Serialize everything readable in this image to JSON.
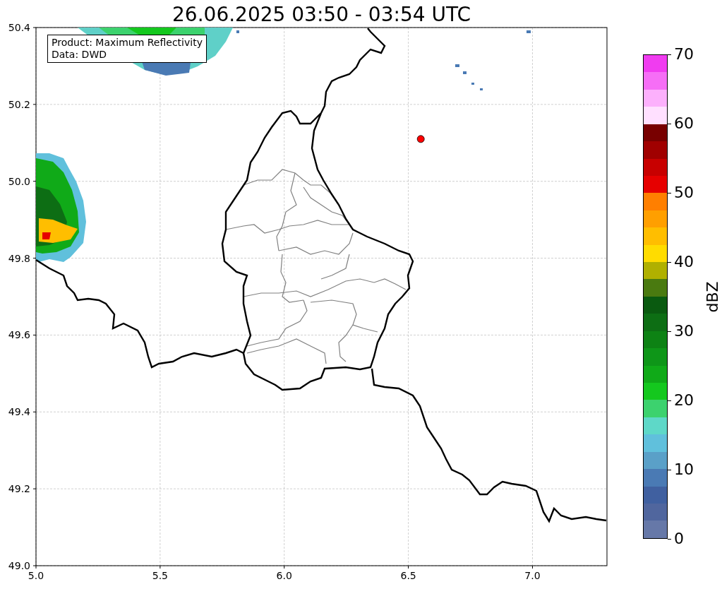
{
  "title": "26.06.2025 03:50 - 03:54 UTC",
  "legend": {
    "lines": [
      "Product: Maximum Reflectivity",
      "Data: DWD"
    ]
  },
  "map": {
    "chart_data": {
      "type": "scatter",
      "xlim": [
        5.0,
        7.3
      ],
      "ylim": [
        49.0,
        50.4
      ],
      "xticks": [
        {
          "value": 5.0,
          "label": "5.0"
        },
        {
          "value": 5.5,
          "label": "5.5"
        },
        {
          "value": 6.0,
          "label": "6.0"
        },
        {
          "value": 6.5,
          "label": "6.5"
        },
        {
          "value": 7.0,
          "label": "7.0"
        }
      ],
      "yticks": [
        {
          "value": 49.0,
          "label": "49.0"
        },
        {
          "value": 49.2,
          "label": "49.2"
        },
        {
          "value": 49.4,
          "label": "49.4"
        },
        {
          "value": 49.6,
          "label": "49.6"
        },
        {
          "value": 49.8,
          "label": "49.8"
        },
        {
          "value": 50.0,
          "label": "50.0"
        },
        {
          "value": 50.2,
          "label": "50.2"
        },
        {
          "value": 50.4,
          "label": "50.4"
        }
      ],
      "x": [
        6.55
      ],
      "grid": true,
      "series": [
        {
          "color": "#ff0000",
          "values": [
            50.11
          ]
        }
      ]
    }
  },
  "colorbar": {
    "label": "dBZ",
    "ticks": [
      "70",
      "60",
      "50",
      "40",
      "30",
      "20",
      "10",
      "0"
    ]
  }
}
